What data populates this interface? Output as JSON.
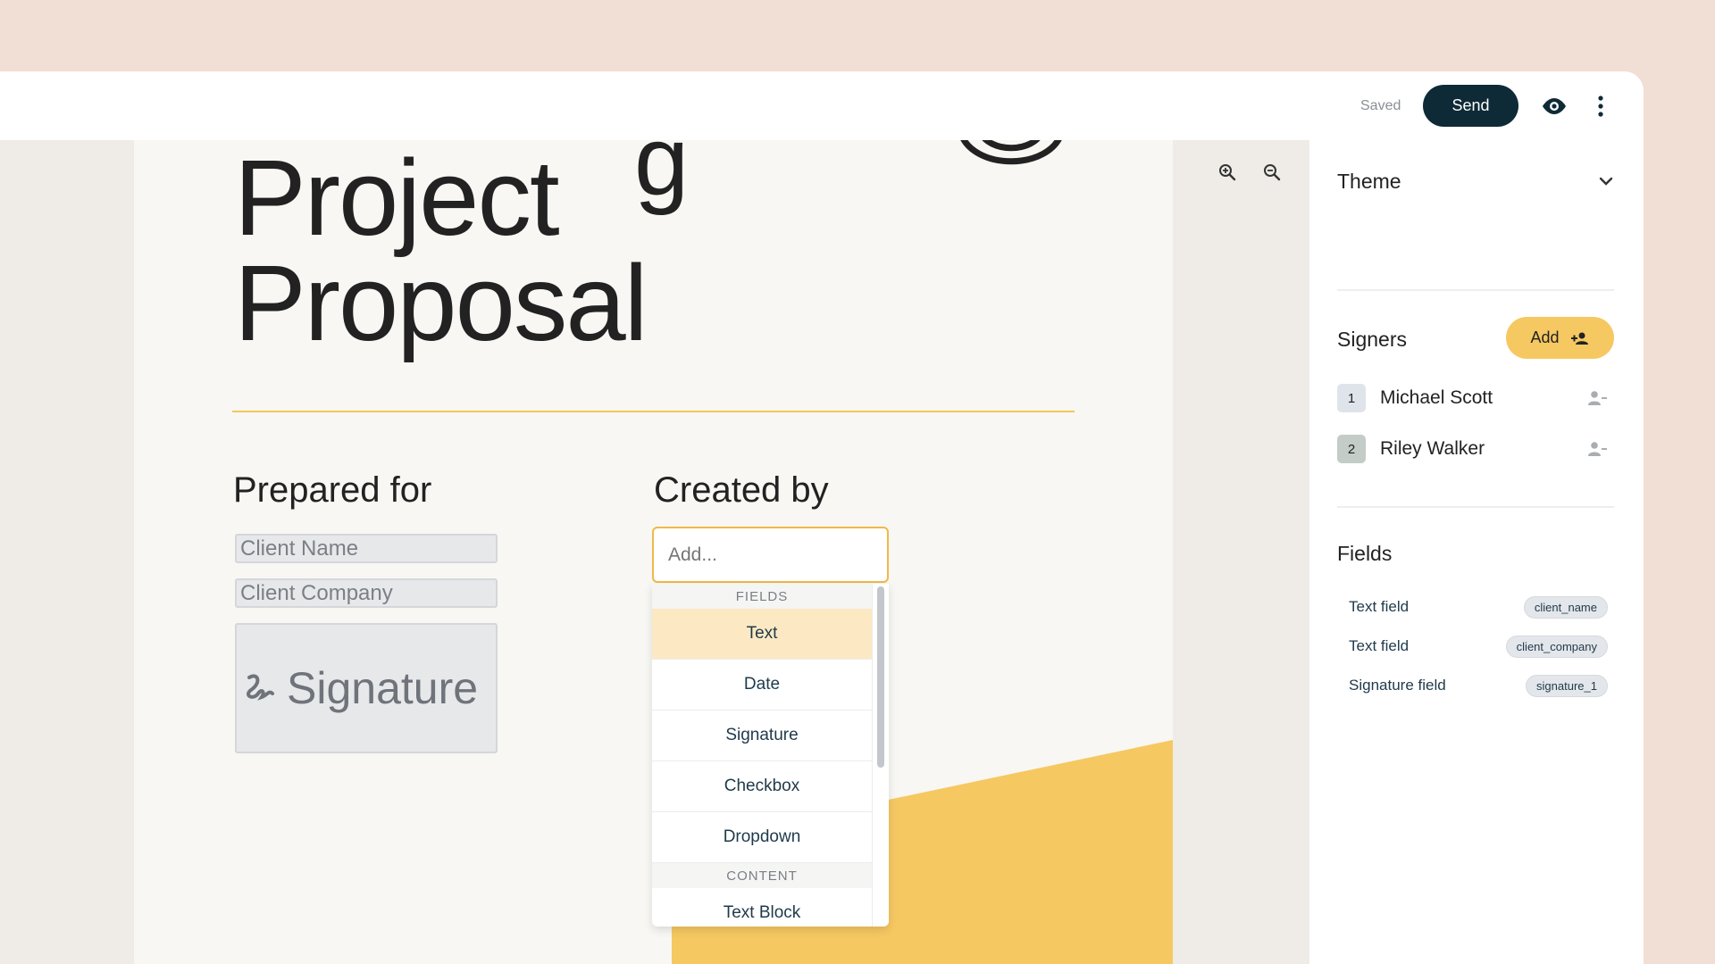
{
  "topbar": {
    "status": "Saved",
    "send_label": "Send",
    "preview_icon": "eye-icon",
    "more_icon": "more-vertical-icon"
  },
  "canvas": {
    "zoom_in_icon": "zoom-in-icon",
    "zoom_out_icon": "zoom-out-icon"
  },
  "document": {
    "title": "Project\nProposal",
    "prepared_for_heading": "Prepared for",
    "created_by_heading": "Created by",
    "fields": {
      "client_name_placeholder": "Client Name",
      "client_company_placeholder": "Client Company",
      "signature_label": "Signature"
    },
    "colors": {
      "accent_yellow": "#f6c862",
      "divider": "#f0c85a"
    }
  },
  "add_menu": {
    "input_placeholder": "Add...",
    "sections": [
      {
        "label": "FIELDS",
        "items": [
          "Text",
          "Date",
          "Signature",
          "Checkbox",
          "Dropdown"
        ]
      },
      {
        "label": "CONTENT",
        "items": [
          "Text Block"
        ]
      }
    ],
    "highlighted_item": "Text"
  },
  "sidebar": {
    "theme_label": "Theme",
    "signers_label": "Signers",
    "add_label": "Add",
    "signers": [
      {
        "num": "1",
        "name": "Michael Scott"
      },
      {
        "num": "2",
        "name": "Riley Walker"
      }
    ],
    "fields_label": "Fields",
    "fields": [
      {
        "type": "Text field",
        "key": "client_name"
      },
      {
        "type": "Text field",
        "key": "client_company"
      },
      {
        "type": "Signature field",
        "key": "signature_1"
      }
    ]
  }
}
